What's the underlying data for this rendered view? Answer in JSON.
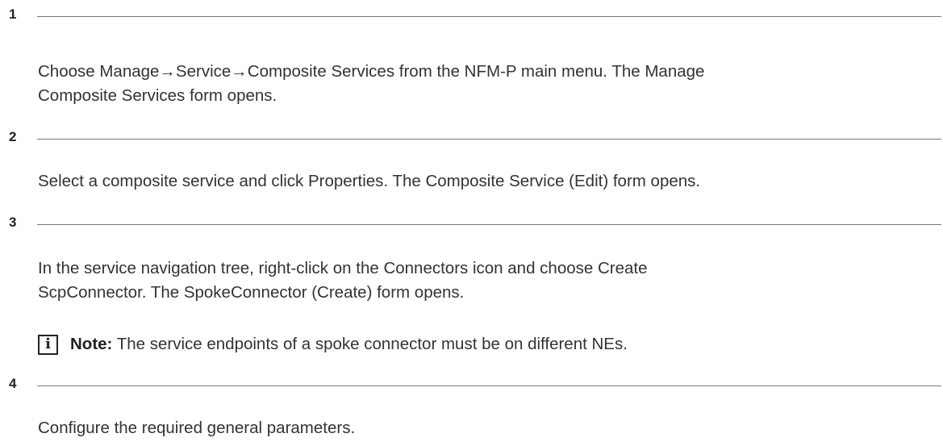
{
  "steps": [
    {
      "number": "1",
      "paragraphs": [
        "Choose Manage→Service→Composite Services from the NFM-P main menu. The Manage",
        "Composite Services form opens."
      ]
    },
    {
      "number": "2",
      "paragraphs": [
        "Select a composite service and click Properties. The Composite Service (Edit) form opens."
      ]
    },
    {
      "number": "3",
      "paragraphs": [
        "In the service navigation tree, right-click on the Connectors icon and choose Create",
        "ScpConnector. The SpokeConnector (Create) form opens."
      ],
      "note": {
        "icon": "info-icon",
        "label": "Note:",
        "text": " The service endpoints of a spoke connector must be on different NEs."
      }
    },
    {
      "number": "4",
      "paragraphs": [
        "Configure the required general parameters."
      ]
    }
  ]
}
